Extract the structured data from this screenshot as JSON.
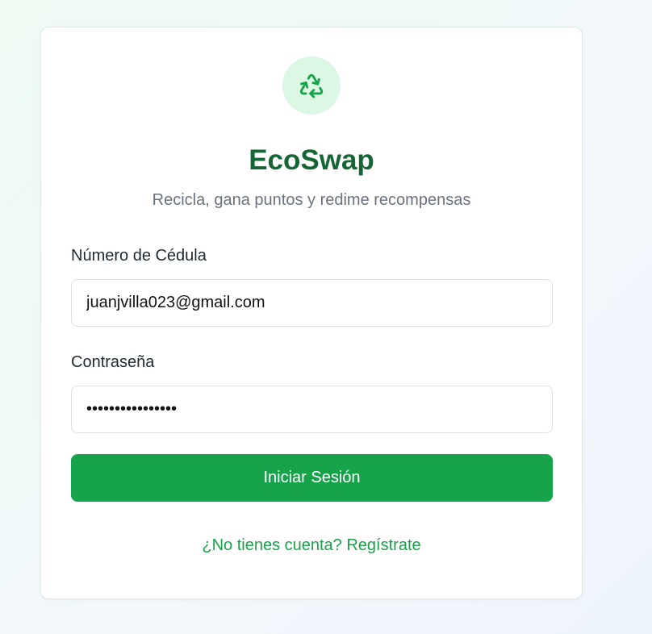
{
  "app": {
    "title": "EcoSwap",
    "subtitle": "Recicla, gana puntos y redime recompensas",
    "logo_icon": "recycle-icon"
  },
  "form": {
    "cedula_label": "Número de Cédula",
    "cedula_value": "juanjvilla023@gmail.com",
    "password_label": "Contraseña",
    "password_value": "••••••••••••••••",
    "submit_label": "Iniciar Sesión"
  },
  "footer": {
    "register_link": "¿No tienes cuenta? Regístrate"
  },
  "colors": {
    "brand_green": "#16a34a",
    "title_green": "#166534",
    "logo_bg": "#dcf7e4"
  }
}
